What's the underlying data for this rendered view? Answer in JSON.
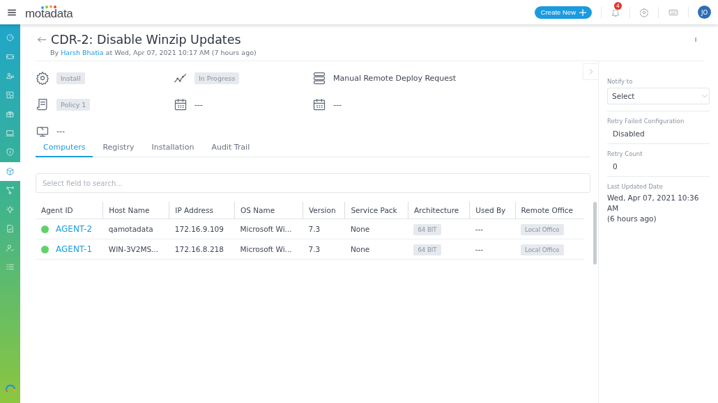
{
  "topbar": {
    "logo": "motadata",
    "create_button": "Create New",
    "notification_count": "4",
    "avatar": "JO"
  },
  "sidebar": {
    "items": [
      {
        "selected": false
      },
      {
        "selected": false
      },
      {
        "selected": false
      },
      {
        "selected": false
      },
      {
        "selected": false
      },
      {
        "selected": false
      },
      {
        "selected": false
      },
      {
        "selected": true
      },
      {
        "selected": false
      },
      {
        "selected": false
      },
      {
        "selected": false
      },
      {
        "selected": false
      },
      {
        "selected": false
      }
    ]
  },
  "header": {
    "title": "CDR-2: Disable Winzip Updates",
    "byline_prefix": "By",
    "author": "Harsh Bhatia",
    "byline_suffix": "at Wed, Apr 07, 2021 10:17 AM (7 hours ago)"
  },
  "details": [
    {
      "kind": "tag",
      "text": "Install"
    },
    {
      "kind": "tag",
      "text": "In Progress"
    },
    {
      "kind": "text",
      "text": "Manual Remote Deploy Request"
    },
    {
      "kind": "tag",
      "text": "Policy 1"
    },
    {
      "kind": "text",
      "text": "---"
    },
    {
      "kind": "text",
      "text": "---"
    },
    {
      "kind": "text",
      "text": "---"
    }
  ],
  "tabs": [
    {
      "label": "Computers",
      "selected": true
    },
    {
      "label": "Registry",
      "selected": false
    },
    {
      "label": "Installation",
      "selected": false
    },
    {
      "label": "Audit Trail",
      "selected": false
    }
  ],
  "search": {
    "placeholder": "Select field to search..."
  },
  "table": {
    "columns": [
      "Agent ID",
      "Host Name",
      "IP Address",
      "OS Name",
      "Version",
      "Service Pack",
      "Architecture",
      "Used By",
      "Remote Office"
    ],
    "rows": [
      {
        "color": "#5fd36b",
        "cells": [
          {
            "kind": "link",
            "text": "AGENT-2"
          },
          {
            "kind": "text",
            "text": "qamotadata"
          },
          {
            "kind": "text",
            "text": "172.16.9.109"
          },
          {
            "kind": "text",
            "text": "Microsoft Wi..."
          },
          {
            "kind": "text",
            "text": "7.3"
          },
          {
            "kind": "text",
            "text": "None"
          },
          {
            "kind": "tag",
            "text": "64 BIT"
          },
          {
            "kind": "text",
            "text": "---"
          },
          {
            "kind": "tag",
            "text": "Local Office"
          }
        ]
      },
      {
        "color": "#5fd36b",
        "cells": [
          {
            "kind": "link",
            "text": "AGENT-1"
          },
          {
            "kind": "text",
            "text": "WIN-3V2MS..."
          },
          {
            "kind": "text",
            "text": "172.16.8.218"
          },
          {
            "kind": "text",
            "text": "Microsoft Wi..."
          },
          {
            "kind": "text",
            "text": "7.3"
          },
          {
            "kind": "text",
            "text": "None"
          },
          {
            "kind": "tag",
            "text": "64 BIT"
          },
          {
            "kind": "text",
            "text": "---"
          },
          {
            "kind": "tag",
            "text": "Local Office"
          }
        ]
      }
    ]
  },
  "side_panel": {
    "fields": [
      {
        "kind": "select",
        "label": "Notify to",
        "value": "Select"
      },
      {
        "kind": "value",
        "label": "Retry Failed Configuration",
        "value": "Disabled"
      },
      {
        "kind": "value",
        "label": "Retry Count",
        "value": "0"
      },
      {
        "kind": "lines",
        "label": "Last Updated Date",
        "value": "Wed, Apr 07, 2021 10:36 AM",
        "note": "(6 hours ago)"
      }
    ]
  }
}
